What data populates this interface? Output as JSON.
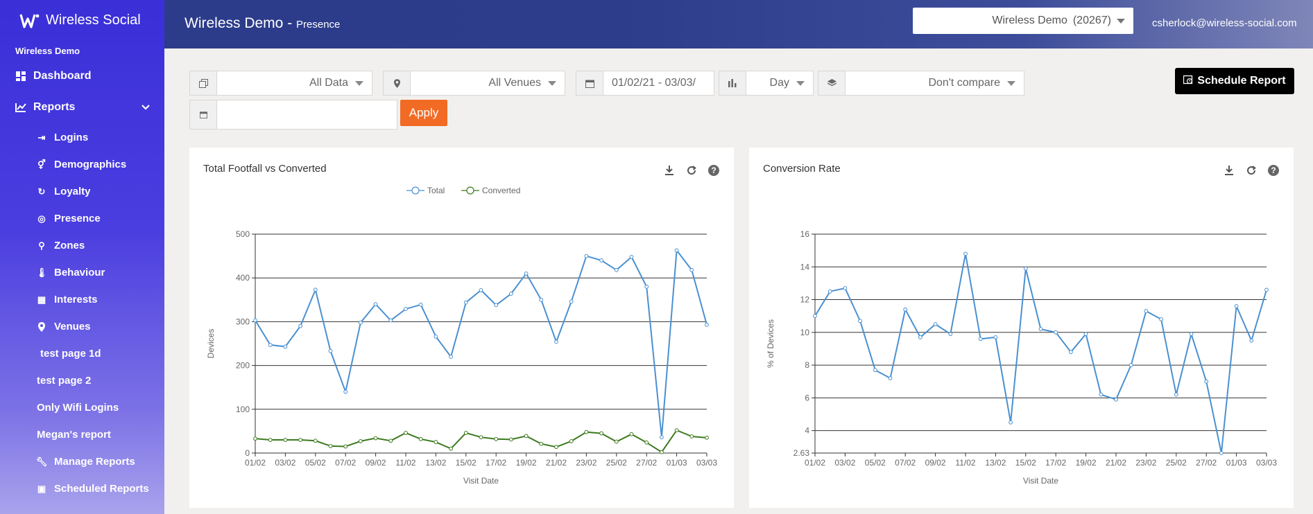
{
  "brand": {
    "name": "Wireless Social"
  },
  "sidebar": {
    "account_name": "Wireless Demo",
    "dashboard": "Dashboard",
    "reports": "Reports",
    "sub_items": [
      "Logins",
      "Demographics",
      "Loyalty",
      "Presence",
      "Zones",
      "Behaviour",
      "Interests",
      "Venues"
    ],
    "custom_items": [
      "test page 1d",
      "test page 2",
      "Only Wifi Logins",
      "Megan's report"
    ],
    "manage_reports": "Manage Reports",
    "scheduled_reports": "Scheduled Reports"
  },
  "header": {
    "title": "Wireless Demo",
    "separator": " - ",
    "subtitle": "Presence",
    "account_selector": "Wireless Demo",
    "account_id": "(20267)",
    "user_email": "csherlock@wireless-social.com"
  },
  "filters": {
    "data_scope": "All Data",
    "venues": "All Venues",
    "date_range": "01/02/21 - 03/03/",
    "granularity": "Day",
    "compare": "Don't compare",
    "compare_date": "",
    "apply_label": "Apply",
    "schedule_label": "Schedule Report"
  },
  "colors": {
    "total": "#4a90d0",
    "converted": "#3c7a1e",
    "apply": "#f26b24"
  },
  "chart_data": [
    {
      "type": "line",
      "title": "Total Footfall vs Converted",
      "xlabel": "Visit Date",
      "ylabel": "Devices",
      "ylim": [
        0,
        500
      ],
      "yticks": [
        0,
        100,
        200,
        300,
        400,
        500
      ],
      "x": [
        "01/02",
        "02/02",
        "03/02",
        "04/02",
        "05/02",
        "06/02",
        "07/02",
        "08/02",
        "09/02",
        "10/02",
        "11/02",
        "12/02",
        "13/02",
        "14/02",
        "15/02",
        "16/02",
        "17/02",
        "18/02",
        "19/02",
        "20/02",
        "21/02",
        "22/02",
        "23/02",
        "24/02",
        "25/02",
        "26/02",
        "27/02",
        "28/02",
        "01/03",
        "02/03",
        "03/03"
      ],
      "xtick_labels": [
        "01/02",
        "03/02",
        "05/02",
        "07/02",
        "09/02",
        "11/02",
        "13/02",
        "15/02",
        "17/02",
        "19/02",
        "21/02",
        "23/02",
        "25/02",
        "27/02",
        "01/03",
        "03/03"
      ],
      "legend": "top-center",
      "series": [
        {
          "name": "Total",
          "color": "#4a90d0",
          "values": [
            303,
            247,
            243,
            290,
            373,
            233,
            140,
            298,
            340,
            303,
            329,
            339,
            266,
            220,
            344,
            372,
            338,
            364,
            410,
            350,
            254,
            346,
            450,
            440,
            418,
            448,
            380,
            36,
            463,
            418,
            293
          ]
        },
        {
          "name": "Converted",
          "color": "#3c7a1e",
          "values": [
            33,
            30,
            30,
            30,
            28,
            16,
            15,
            27,
            34,
            28,
            46,
            32,
            25,
            10,
            46,
            36,
            32,
            31,
            39,
            21,
            14,
            27,
            48,
            45,
            26,
            43,
            24,
            2,
            52,
            38,
            35
          ]
        }
      ]
    },
    {
      "type": "line",
      "title": "Conversion Rate",
      "xlabel": "Visit Date",
      "ylabel": "% of Devices",
      "ylim": [
        2.63,
        16
      ],
      "yticks": [
        2.63,
        4,
        6,
        8,
        10,
        12,
        14,
        16
      ],
      "ytick_labels": [
        "2.63",
        "4",
        "6",
        "8",
        "10",
        "12",
        "14",
        "16"
      ],
      "x": [
        "01/02",
        "02/02",
        "03/02",
        "04/02",
        "05/02",
        "06/02",
        "07/02",
        "08/02",
        "09/02",
        "10/02",
        "11/02",
        "12/02",
        "13/02",
        "14/02",
        "15/02",
        "16/02",
        "17/02",
        "18/02",
        "19/02",
        "20/02",
        "21/02",
        "22/02",
        "23/02",
        "24/02",
        "25/02",
        "26/02",
        "27/02",
        "28/02",
        "01/03",
        "02/03",
        "03/03"
      ],
      "xtick_labels": [
        "01/02",
        "03/02",
        "05/02",
        "07/02",
        "09/02",
        "11/02",
        "13/02",
        "15/02",
        "17/02",
        "19/02",
        "21/02",
        "23/02",
        "25/02",
        "27/02",
        "01/03",
        "03/03"
      ],
      "series": [
        {
          "name": "",
          "color": "#4a90d0",
          "values": [
            11.0,
            12.5,
            12.7,
            10.7,
            7.7,
            7.2,
            11.4,
            9.7,
            10.5,
            9.9,
            14.8,
            9.6,
            9.7,
            4.5,
            13.9,
            10.2,
            10.0,
            8.8,
            9.9,
            6.2,
            5.9,
            8.0,
            11.3,
            10.8,
            6.2,
            9.9,
            7.0,
            2.63,
            11.6,
            9.5,
            12.6
          ]
        }
      ]
    }
  ]
}
